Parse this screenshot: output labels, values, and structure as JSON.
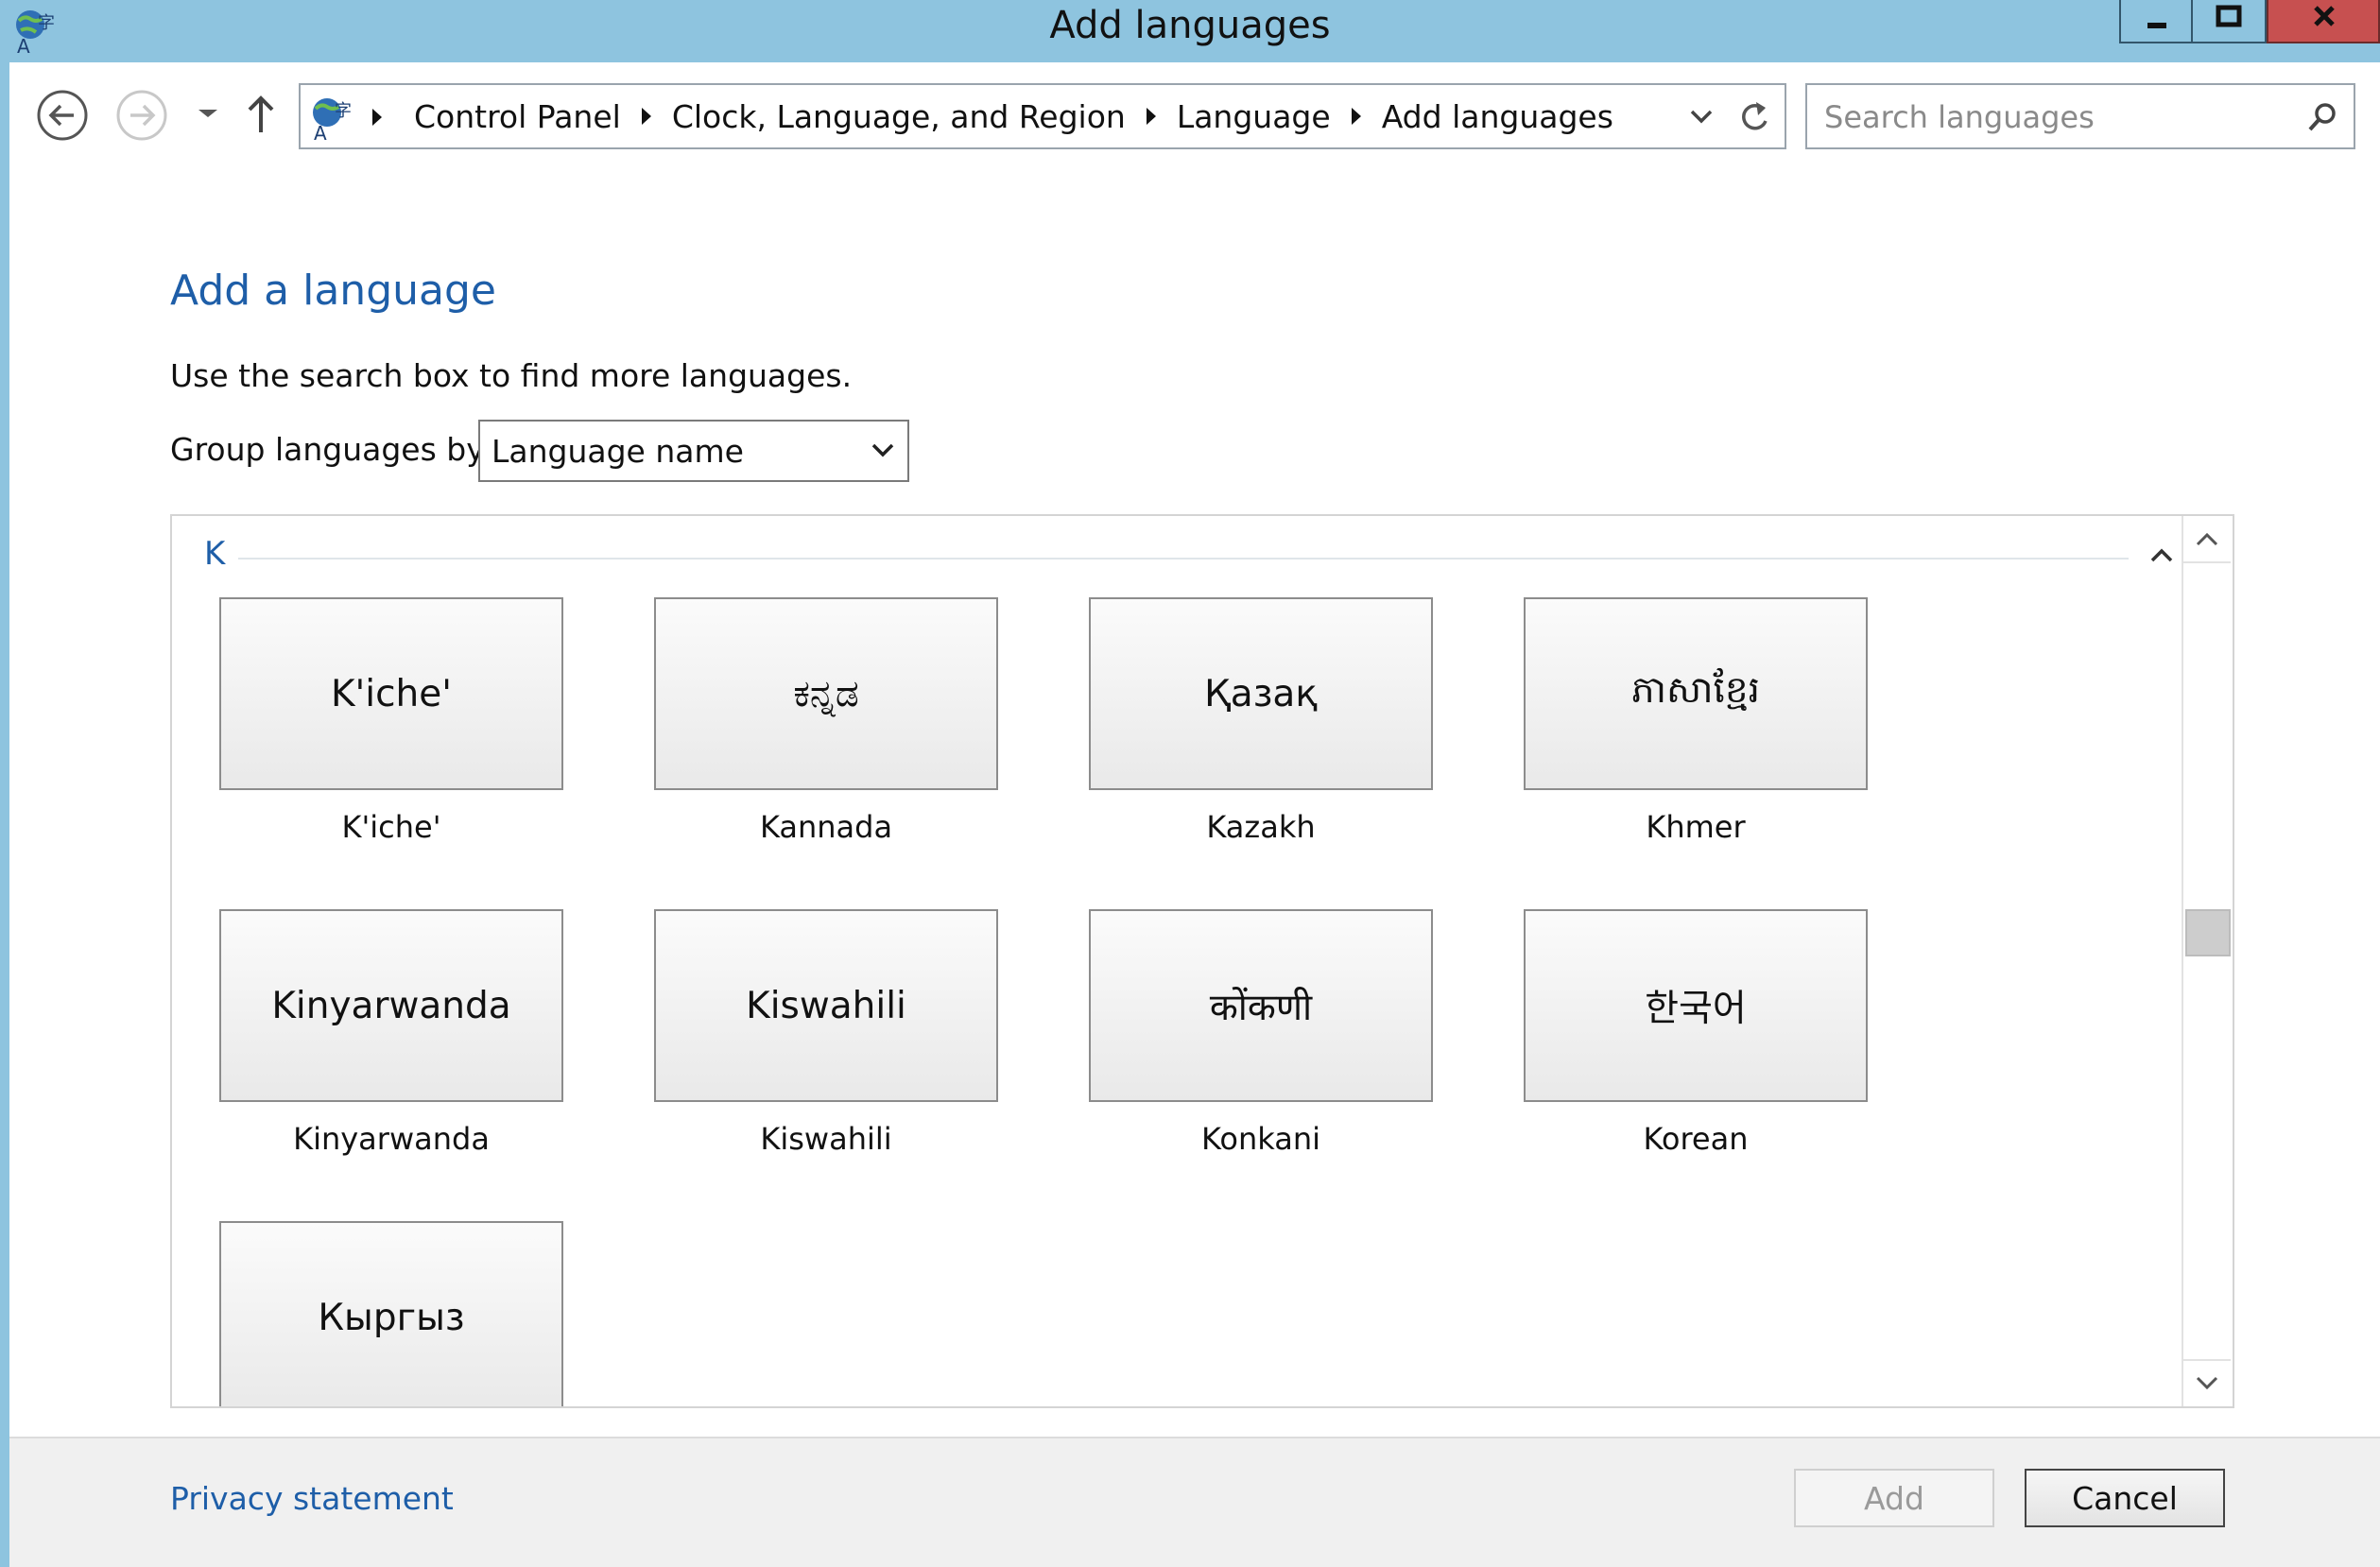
{
  "window": {
    "title": "Add languages"
  },
  "navigation": {
    "breadcrumbs": [
      "Control Panel",
      "Clock, Language, and Region",
      "Language",
      "Add languages"
    ],
    "search_placeholder": "Search languages"
  },
  "content": {
    "heading": "Add a language",
    "instructions": "Use the search box to find more languages.",
    "group_by_label": "Group languages by:",
    "group_by_value": "Language name",
    "group_letter": "K",
    "languages": [
      {
        "native": "K'iche'",
        "name": "K'iche'"
      },
      {
        "native": "ಕನ್ನಡ",
        "name": "Kannada"
      },
      {
        "native": "Қазақ",
        "name": "Kazakh"
      },
      {
        "native": "ភាសាខ្មែរ",
        "name": "Khmer"
      },
      {
        "native": "Kinyarwanda",
        "name": "Kinyarwanda"
      },
      {
        "native": "Kiswahili",
        "name": "Kiswahili"
      },
      {
        "native": "कोंकणी",
        "name": "Konkani"
      },
      {
        "native": "한국어",
        "name": "Korean"
      },
      {
        "native": "Кыргыз",
        "name": ""
      }
    ]
  },
  "footer": {
    "privacy_link": "Privacy statement",
    "add_button": "Add",
    "cancel_button": "Cancel"
  }
}
